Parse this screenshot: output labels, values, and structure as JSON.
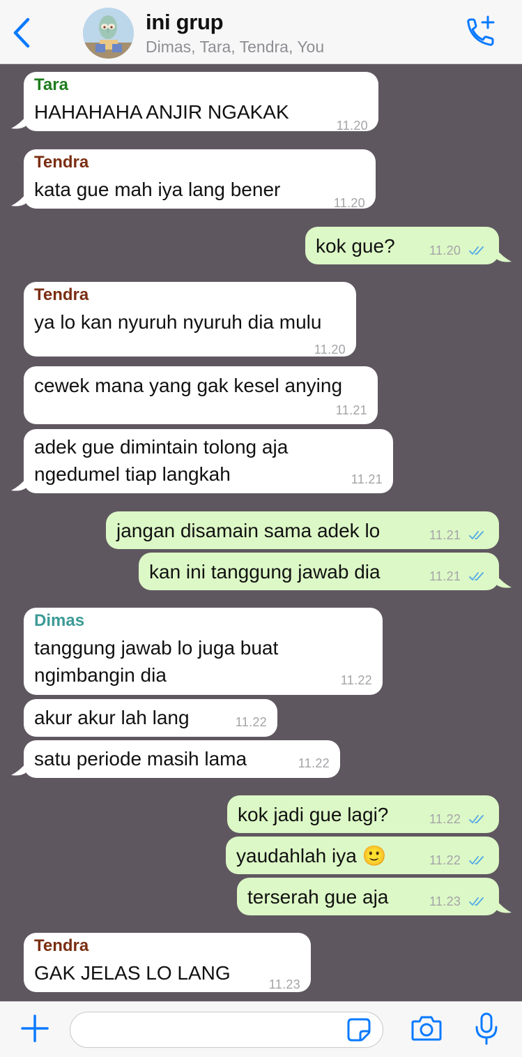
{
  "header": {
    "title": "ini grup",
    "subtitle": "Dimas, Tara, Tendra, You"
  },
  "colors": {
    "accent": "#0a7aff",
    "chat_bg": "#5f5760",
    "incoming": "#ffffff",
    "outgoing": "#dcf8c6",
    "sender_tara": "#1e7d1e",
    "sender_tendra": "#7a2e12",
    "sender_dimas": "#3c9a96",
    "read_ticks": "#4fa8e6"
  },
  "messages": [
    {
      "dir": "in",
      "sender": "Tara",
      "text": "HAHAHAHA ANJIR NGAKAK",
      "time": "11.20"
    },
    {
      "dir": "in",
      "sender": "Tendra",
      "text": "kata gue mah iya lang bener",
      "time": "11.20"
    },
    {
      "dir": "out",
      "text": "kok gue?",
      "time": "11.20"
    },
    {
      "dir": "in",
      "sender": "Tendra",
      "text": "ya lo kan nyuruh nyuruh dia mulu",
      "time": "11.20"
    },
    {
      "dir": "in",
      "text": "cewek mana yang gak kesel anying",
      "time": "11.21"
    },
    {
      "dir": "in",
      "text": "adek gue dimintain tolong aja\nngedumel tiap langkah",
      "time": "11.21"
    },
    {
      "dir": "out",
      "text": "jangan disamain sama adek lo",
      "time": "11.21"
    },
    {
      "dir": "out",
      "text": "kan ini tanggung jawab dia",
      "time": "11.21"
    },
    {
      "dir": "in",
      "sender": "Dimas",
      "text": "tanggung jawab lo juga buat\nngimbangin dia",
      "time": "11.22"
    },
    {
      "dir": "in",
      "text": "akur akur lah lang",
      "time": "11.22"
    },
    {
      "dir": "in",
      "text": "satu periode masih lama",
      "time": "11.22"
    },
    {
      "dir": "out",
      "text": "kok jadi gue lagi?",
      "time": "11.22"
    },
    {
      "dir": "out",
      "text": "yaudahlah iya 🙂",
      "time": "11.22"
    },
    {
      "dir": "out",
      "text": "terserah gue aja",
      "time": "11.23"
    },
    {
      "dir": "in",
      "sender": "Tendra",
      "text": "GAK JELAS LO LANG",
      "time": "11.23"
    }
  ],
  "input": {
    "value": "",
    "placeholder": ""
  }
}
